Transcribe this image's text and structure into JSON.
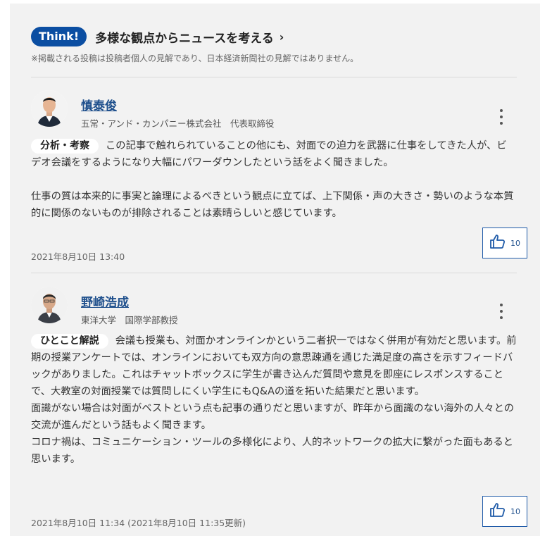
{
  "header": {
    "badge": "Think!",
    "title": "多様な観点からニュースを考える",
    "disclaimer": "※掲載される投稿は投稿者個人の見解であり、日本経済新聞社の見解ではありません。"
  },
  "comments": [
    {
      "author": "慎泰俊",
      "title": "五常・アンド・カンパニー株式会社　代表取締役",
      "tag": "分析・考察",
      "paragraphs": [
        "この記事で触れられていることの他にも、対面での迫力を武器に仕事をしてきた人が、ビデオ会議をするようになり大幅にパワーダウンしたという話をよく聞きました。",
        "仕事の質は本来的に事実と論理によるべきという観点に立てば、上下関係・声の大きさ・勢いのような本質的に関係のないものが排除されることは素晴らしいと感じています。"
      ],
      "date": "2021年8月10日 13:40",
      "likes": "10"
    },
    {
      "author": "野崎浩成",
      "title": "東洋大学　国際学部教授",
      "tag": "ひとこと解説",
      "paragraphs": [
        "会議も授業も、対面かオンラインかという二者択一ではなく併用が有効だと思います。前期の授業アンケートでは、オンラインにおいても双方向の意思疎通を通じた満足度の高さを示すフィードバックがありました。これはチャットボックスに学生が書き込んだ質問や意見を即座にレスポンスすることで、大教室の対面授業では質問しにくい学生にもQ&Aの道を拓いた結果だと思います。",
        "面識がない場合は対面がベストという点も記事の通りだと思いますが、昨年から面識のない海外の人々との交流が進んだという話もよく聞きます。",
        "コロナ禍は、コミュニケーション・ツールの多様化により、人的ネットワークの拡大に繋がった面もあると思います。"
      ],
      "date": "2021年8月10日 11:34 (2021年8月10日 11:35更新)",
      "likes": "10"
    }
  ],
  "icons": {
    "like": "thumbs-up-icon",
    "more": "more-vertical-icon",
    "chevron": "chevron-right-icon"
  },
  "colors": {
    "brand": "#0b4ea2",
    "author_link": "#1e4f8c",
    "panel_bg": "#f2f2f2"
  }
}
